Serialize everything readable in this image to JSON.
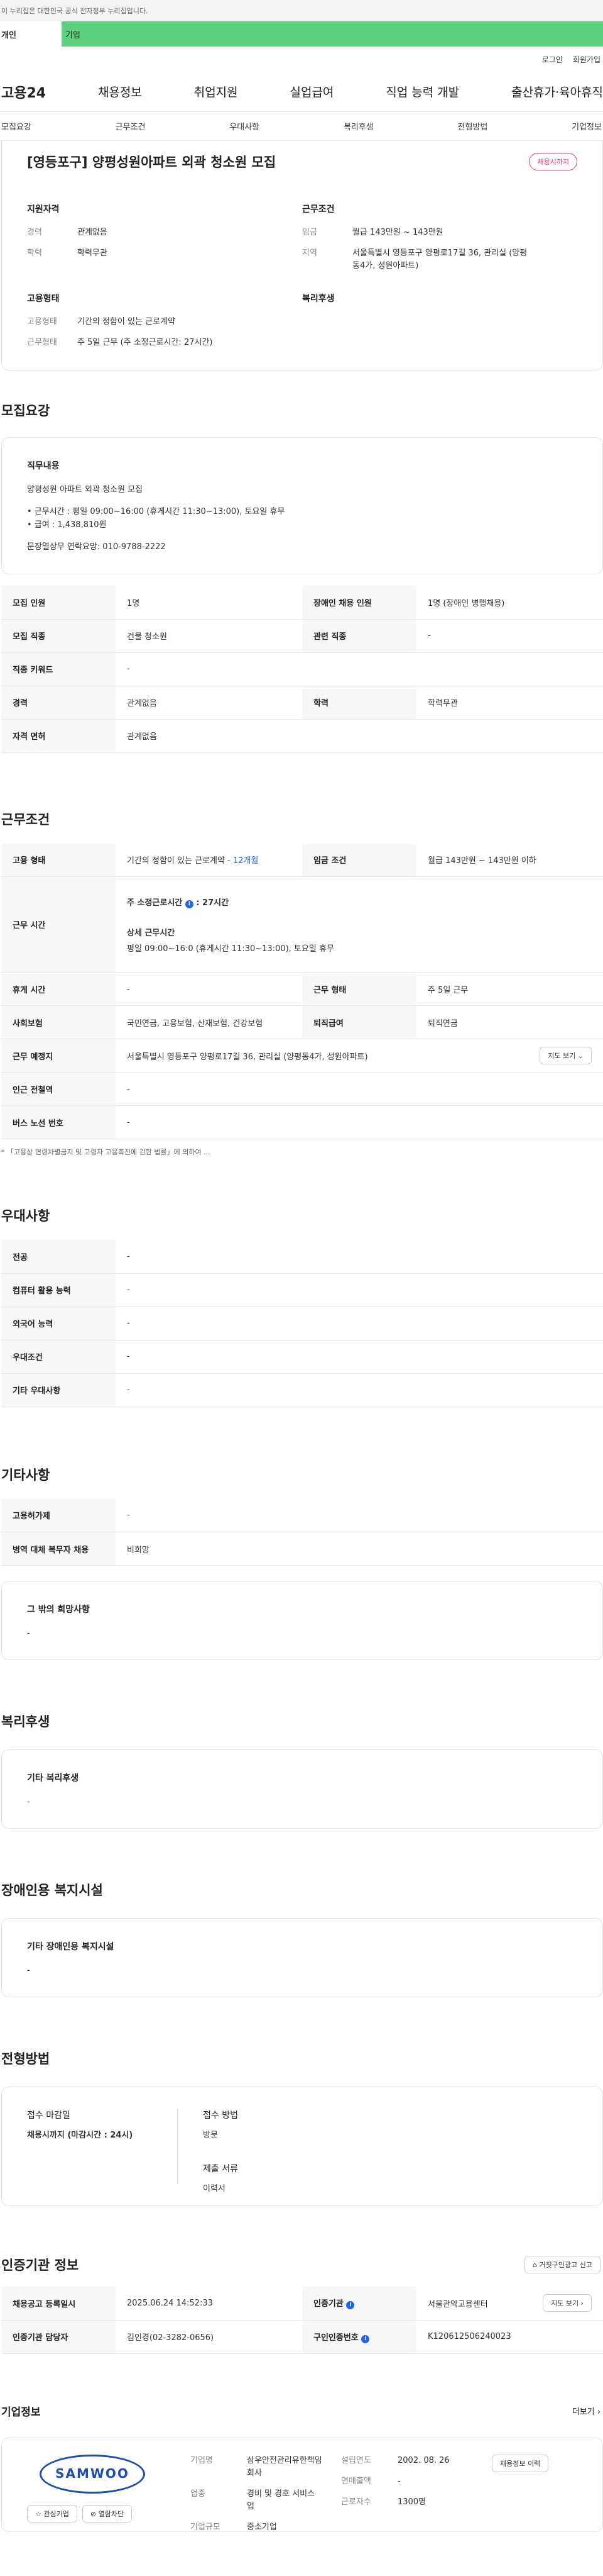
{
  "banner": "이 누리집은 대한민국 공식 전자정부 누리집입니다.",
  "greenbar": {
    "left": "개인",
    "right": "기업"
  },
  "util": {
    "login": "로그인",
    "join": "회원가입"
  },
  "nav": {
    "logo": "고용24",
    "items": [
      "채용정보",
      "취업지원",
      "실업급여",
      "직업 능력 개발",
      "출산휴가·육아휴직"
    ]
  },
  "tabs": [
    "모집요강",
    "근무조건",
    "우대사항",
    "복리후생",
    "전형방법",
    "기업정보"
  ],
  "job": {
    "title": "[영등포구] 양평성원아파트 외곽 청소원 모집",
    "badge": "채용시까지",
    "qual_h": "지원자격",
    "cond_h": "근무조건",
    "career_k": "경력",
    "career_v": "관계없음",
    "edu_k": "학력",
    "edu_v": "학력무관",
    "wage_k": "임금",
    "wage_v": "월급 143만원 ~ 143만원",
    "region_k": "지역",
    "region_v": "서울특별시 영등포구 양평로17길 36, 관리실 (양평동4가, 성원아파트)",
    "emp_h": "고용형태",
    "welfare_h": "복리후생",
    "emptype_k": "고용형태",
    "emptype_v": "기간의 정함이 있는 근로계약",
    "worktype_k": "근무형태",
    "worktype_v": "주 5일 근무 (주 소정근로시간: 27시간)"
  },
  "recruit": {
    "h": "모집요강",
    "job_h": "직무내용",
    "lines": [
      "양평성원 아파트 외곽 청소원 모집",
      "• 근무시간 : 평일 09:00~16:00 (휴게시간 11:30~13:00), 토요일 휴무",
      "• 급여 : 1,438,810원",
      "문장열상무 연락요망: 010-9788-2222"
    ],
    "rows": [
      {
        "k1": "모집 인원",
        "v1": "1명",
        "k2": "장애인 채용 인원",
        "v2": "1명 (장애인 병행채용)"
      },
      {
        "k1": "모집 직종",
        "v1": "건물 청소원",
        "k2": "관련 직종",
        "v2": "-"
      },
      {
        "k1": "직종 키워드",
        "v1": "-"
      },
      {
        "k1": "경력",
        "v1": "관계없음",
        "k2": "학력",
        "v2": "학력무관"
      },
      {
        "k1": "자격 면허",
        "v1": "관계없음"
      }
    ]
  },
  "conditions": {
    "h": "근무조건",
    "emp_k": "고용 형태",
    "emp_v": "기간의 정함이 있는 근로계약 - ",
    "emp_blue": "12개월",
    "wage_k": "임금 조건",
    "wage_v": "월급 143만원 ~ 143만원 이하",
    "time_k": "근무 시간",
    "time_label": "주 소정근로시간",
    "time_val": ": 27시간",
    "detail_h": "상세 근무시간",
    "detail_v": "평일 09:00~16:0 (휴게시간 11:30~13:00), 토요일 휴무",
    "rest_k": "휴게 시간",
    "rest_v": "-",
    "form_k": "근무 형태",
    "form_v": "주 5일 근무",
    "ins_k": "사회보험",
    "ins_v": "국민연금, 고용보험, 산재보험, 건강보험",
    "ret_k": "퇴직급여",
    "ret_v": "퇴직연금",
    "place_k": "근무 예정지",
    "place_v": "서울특별시 영등포구 양평로17길 36, 관리실 (양평동4가, 성원아파트)",
    "map_btn": "지도 보기",
    "subway_k": "인근 전철역",
    "subway_v": "-",
    "bus_k": "버스 노선 번호",
    "bus_v": "-",
    "note": "* 「고용상 연령차별금지 및 고령자 고용촉진에 관한 법률」에 의하여 ..."
  },
  "pref": {
    "h": "우대사항",
    "rows": [
      {
        "k": "전공",
        "v": "-"
      },
      {
        "k": "컴퓨터 활용 능력",
        "v": "-"
      },
      {
        "k": "외국어 능력",
        "v": "-"
      },
      {
        "k": "우대조건",
        "v": "-"
      },
      {
        "k": "기타 우대사항",
        "v": "-"
      }
    ]
  },
  "etc": {
    "h": "기타사항",
    "rows": [
      {
        "k": "고용허가제",
        "v": "-"
      },
      {
        "k": "병역 대체 복무자 채용",
        "v": "비희망"
      }
    ],
    "box_h": "그 밖의 희망사항",
    "box_v": "-"
  },
  "welfare": {
    "h": "복리후생",
    "box_h": "기타 복리후생",
    "box_v": "-"
  },
  "disab": {
    "h": "장애인용 복지시설",
    "box_h": "기타 장애인용 복지시설",
    "box_v": "-"
  },
  "process": {
    "h": "전형방법",
    "deadline_h": "접수 마감일",
    "deadline_v": "채용시까지 (마감시간 : 24시)",
    "method_h": "접수 방법",
    "method_v": "방문",
    "docs_h": "제출 서류",
    "docs_v": "이력서"
  },
  "cert": {
    "h": "인증기관 정보",
    "report_btn": "거짓구인광고 신고",
    "reg_k": "채용공고 등록일시",
    "reg_v": "2025.06.24 14:52:33",
    "org_k": "인증기관",
    "org_v": "서울관악고용센터",
    "map_btn": "지도 보기",
    "mgr_k": "인증기관 담당자",
    "mgr_v": "김인경(02-3282-0656)",
    "num_k": "구인인증번호",
    "num_v": "K120612506240023"
  },
  "company": {
    "h": "기업정보",
    "more": "더보기",
    "logo": "SAMWOO",
    "fav_btn": "관심기업",
    "block_btn": "열람차단",
    "name_k": "기업명",
    "name_v": "삼우안전관리유한책임회사",
    "ind_k": "업종",
    "ind_v": "경비 및 경호 서비스업",
    "size_k": "기업규모",
    "size_v": "중소기업",
    "year_k": "설립연도",
    "year_v": "2002. 08. 26",
    "sales_k": "연매출액",
    "sales_v": "-",
    "emp_k": "근로자수",
    "emp_v": "1300명",
    "hist_btn": "채용정보 이력"
  }
}
